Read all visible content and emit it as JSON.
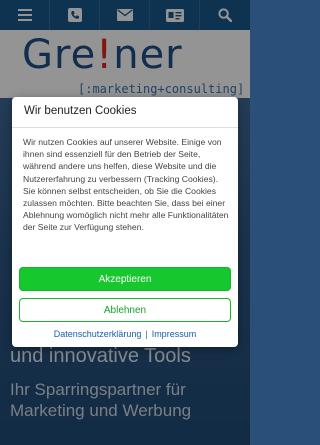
{
  "nav": {
    "icons": [
      "menu-icon",
      "phone-icon",
      "mail-icon",
      "contact-card-icon",
      "search-icon"
    ]
  },
  "logo": {
    "word_before": "Gre",
    "word_mark": "!",
    "word_after": "ner",
    "tagline": "[:marketing+consulting]"
  },
  "hero": {
    "line1": "und innovative Tools",
    "line2": "Ihr Sparringspartner für Marketing und Werbung"
  },
  "cookie": {
    "title": "Wir benutzen Cookies",
    "body": "Wir nutzen Cookies auf unserer Website. Einige von ihnen sind essenziell für den Betrieb der Seite, während andere uns helfen, diese Website und die Nutzererfahrung zu verbessern (Tracking Cookies). Sie können selbst entscheiden, ob Sie die Cookies zulassen möchten. Bitte beachten Sie, dass bei einer Ablehnung womöglich nicht mehr alle Funktionalitäten der Seite zur Verfügung stehen.",
    "accept_label": "Akzeptieren",
    "reject_label": "Ablehnen",
    "privacy_link": "Datenschutzerklärung",
    "separator": "|",
    "imprint_link": "Impressum"
  },
  "colors": {
    "nav_bg": "#17598c",
    "brand_blue": "#1f4f86",
    "accent_red": "#e2231a",
    "accept_green": "#16c72e",
    "link_blue": "#1560a8"
  }
}
